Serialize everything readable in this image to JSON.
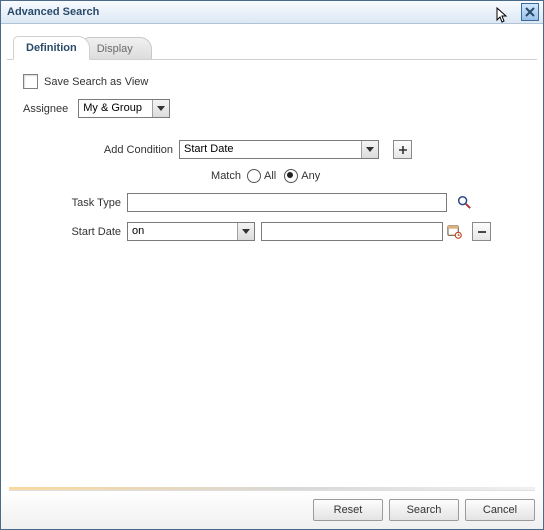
{
  "window": {
    "title": "Advanced Search"
  },
  "tabs": {
    "definition": "Definition",
    "display": "Display"
  },
  "form": {
    "save_as_view_label": "Save Search as View",
    "assignee_label": "Assignee",
    "assignee_value": "My & Group",
    "add_condition_label": "Add Condition",
    "add_condition_value": "Start Date",
    "match_label": "Match",
    "match_option_all": "All",
    "match_option_any": "Any",
    "match_selected": "any",
    "task_type_label": "Task Type",
    "task_type_value": "",
    "start_date_label": "Start Date",
    "start_date_op_value": "on",
    "start_date_value": ""
  },
  "footer": {
    "reset": "Reset",
    "search": "Search",
    "cancel": "Cancel"
  }
}
